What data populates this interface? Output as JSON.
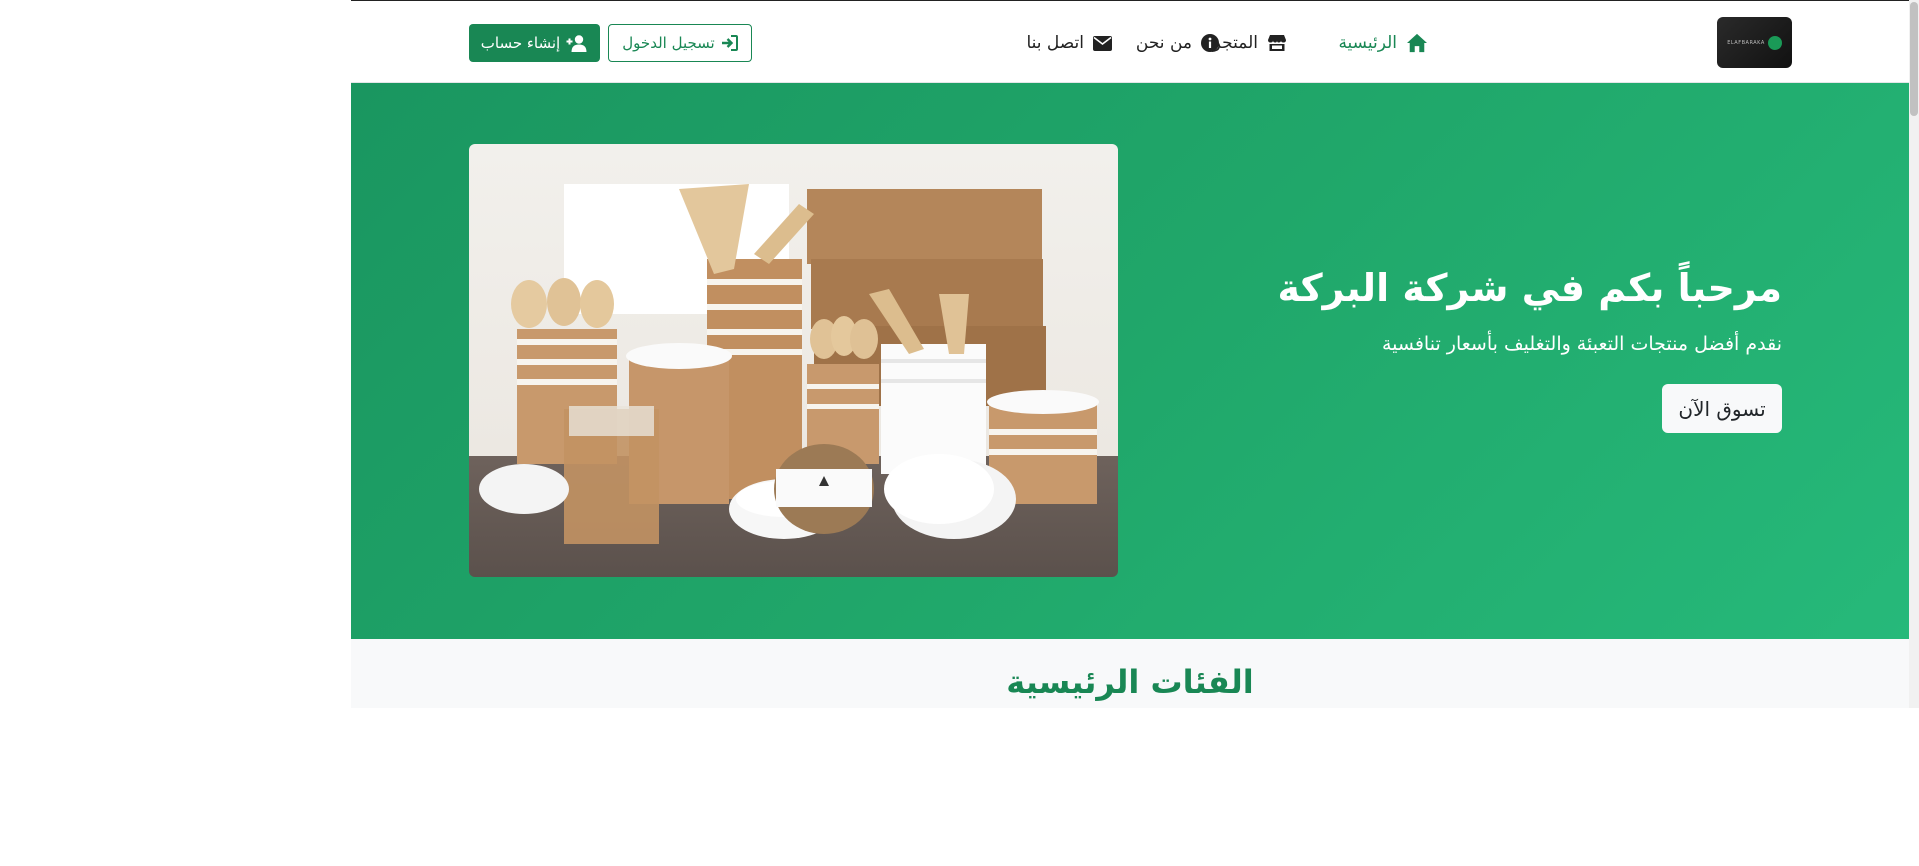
{
  "brand": {
    "logo_text": "ELAFBARAKA",
    "accent_color": "#198754",
    "hero_gradient": [
      "#1a9660",
      "#26b97a"
    ]
  },
  "nav": {
    "items": [
      {
        "label": "الرئيسية",
        "icon": "home-icon",
        "active": true
      },
      {
        "label": "المتجر",
        "icon": "store-icon",
        "active": false
      },
      {
        "label": "من نحن",
        "icon": "info-icon",
        "active": false
      },
      {
        "label": "اتصل بنا",
        "icon": "envelope-icon",
        "active": false
      }
    ],
    "login_label": "تسجيل الدخول",
    "register_label": "إنشاء حساب"
  },
  "hero": {
    "title": "مرحباً بكم في شركة البركة",
    "subtitle": "نقدم أفضل منتجات التعبئة والتغليف بأسعار تنافسية",
    "cta_label": "تسوق الآن"
  },
  "categories": {
    "title": "الفئات الرئيسية"
  }
}
